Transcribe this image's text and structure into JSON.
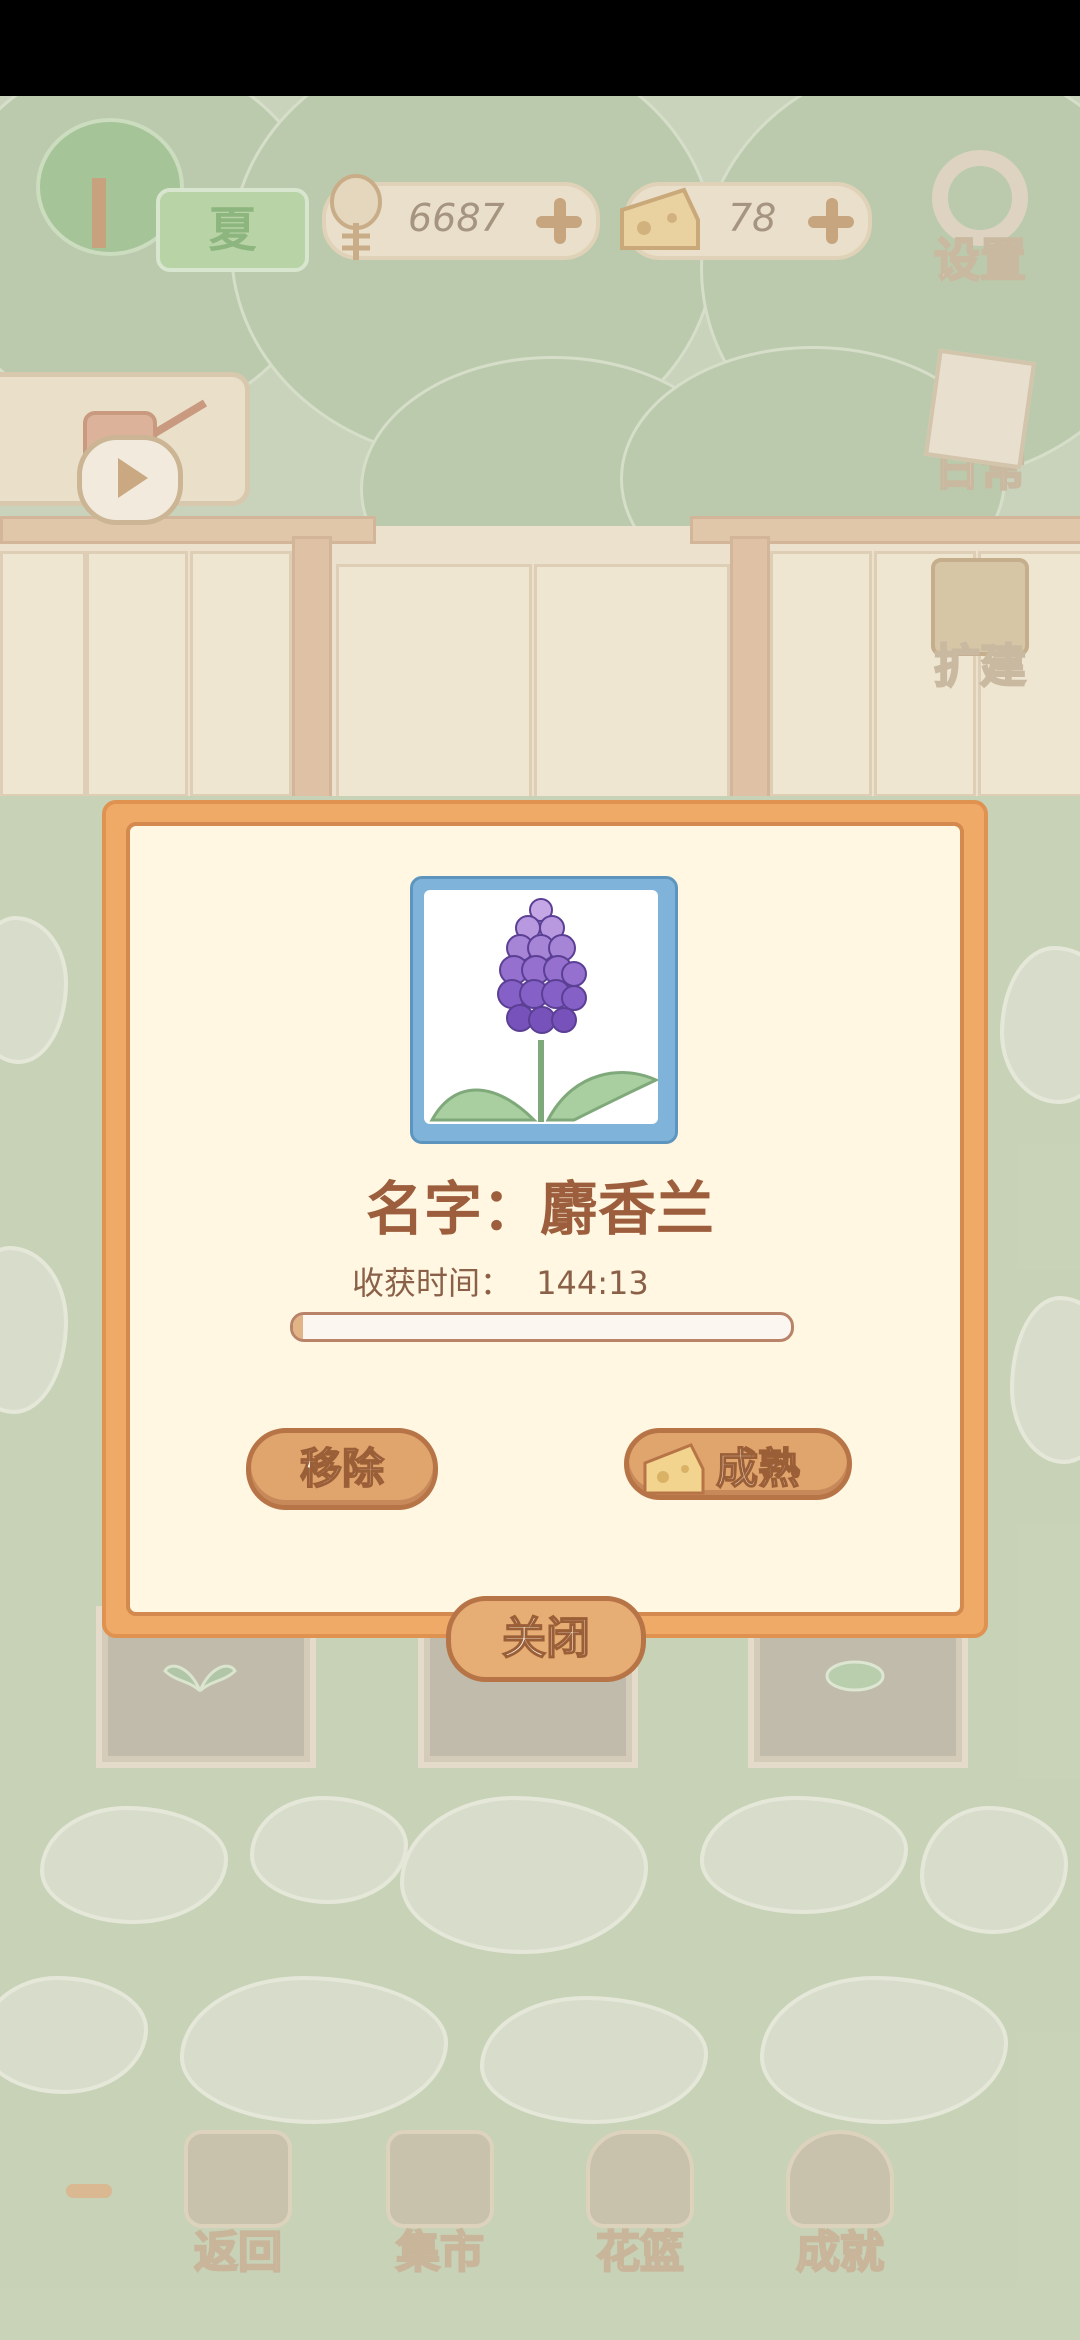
{
  "hud": {
    "season_label": "夏",
    "fish_count": "6687",
    "cheese_count": "78",
    "settings_label": "设置",
    "daily_label": "日常",
    "expand_label": "扩建"
  },
  "dialog": {
    "name_label": "名字：麝香兰",
    "harvest_label": "收获时间：",
    "harvest_time": "144:13",
    "progress": 0.02,
    "remove_label": "移除",
    "ripen_label": "成熟",
    "close_label": "关闭"
  },
  "nav": {
    "items": [
      {
        "label": "返回"
      },
      {
        "label": "集市"
      },
      {
        "label": "花篮"
      },
      {
        "label": "成就"
      }
    ]
  },
  "colors": {
    "accent": "#f0aa68",
    "button": "#e0a46d",
    "text_brown": "#9c5e3c",
    "flower_purple": "#8a63c7"
  }
}
